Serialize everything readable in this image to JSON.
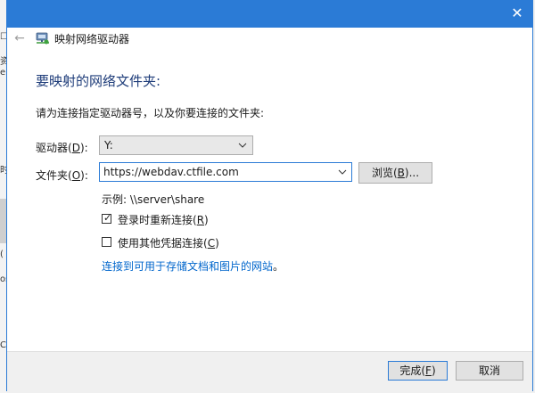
{
  "window": {
    "title": "映射网络驱动器",
    "close_symbol": "✕",
    "back_symbol": "←"
  },
  "heading": "要映射的网络文件夹:",
  "instruction": "请为连接指定驱动器号，以及你要连接的文件夹:",
  "drive": {
    "label_pre": "驱动器(",
    "label_key": "D",
    "label_post": "):",
    "value": "Y:"
  },
  "folder": {
    "label_pre": "文件夹(",
    "label_key": "O",
    "label_post": "):",
    "value": "https://webdav.ctfile.com",
    "browse_pre": "浏览(",
    "browse_key": "B",
    "browse_post": ")..."
  },
  "example": "示例: \\\\server\\share",
  "reconnect": {
    "checked": true,
    "label_pre": "登录时重新连接(",
    "label_key": "R",
    "label_post": ")"
  },
  "other_credentials": {
    "checked": false,
    "label_pre": "使用其他凭据连接(",
    "label_key": "C",
    "label_post": ")"
  },
  "link": {
    "text": "连接到可用于存储文档和图片的网站",
    "suffix": "。"
  },
  "footer": {
    "finish_pre": "完成(",
    "finish_key": "F",
    "finish_post": ")",
    "cancel": "取消"
  },
  "colors": {
    "accent": "#2b7bd6",
    "heading": "#1f3d7a",
    "link": "#0066cc"
  },
  "background_fragments": [
    "☐",
    "资",
    "e",
    "时",
    "(",
    "os",
    "C"
  ]
}
